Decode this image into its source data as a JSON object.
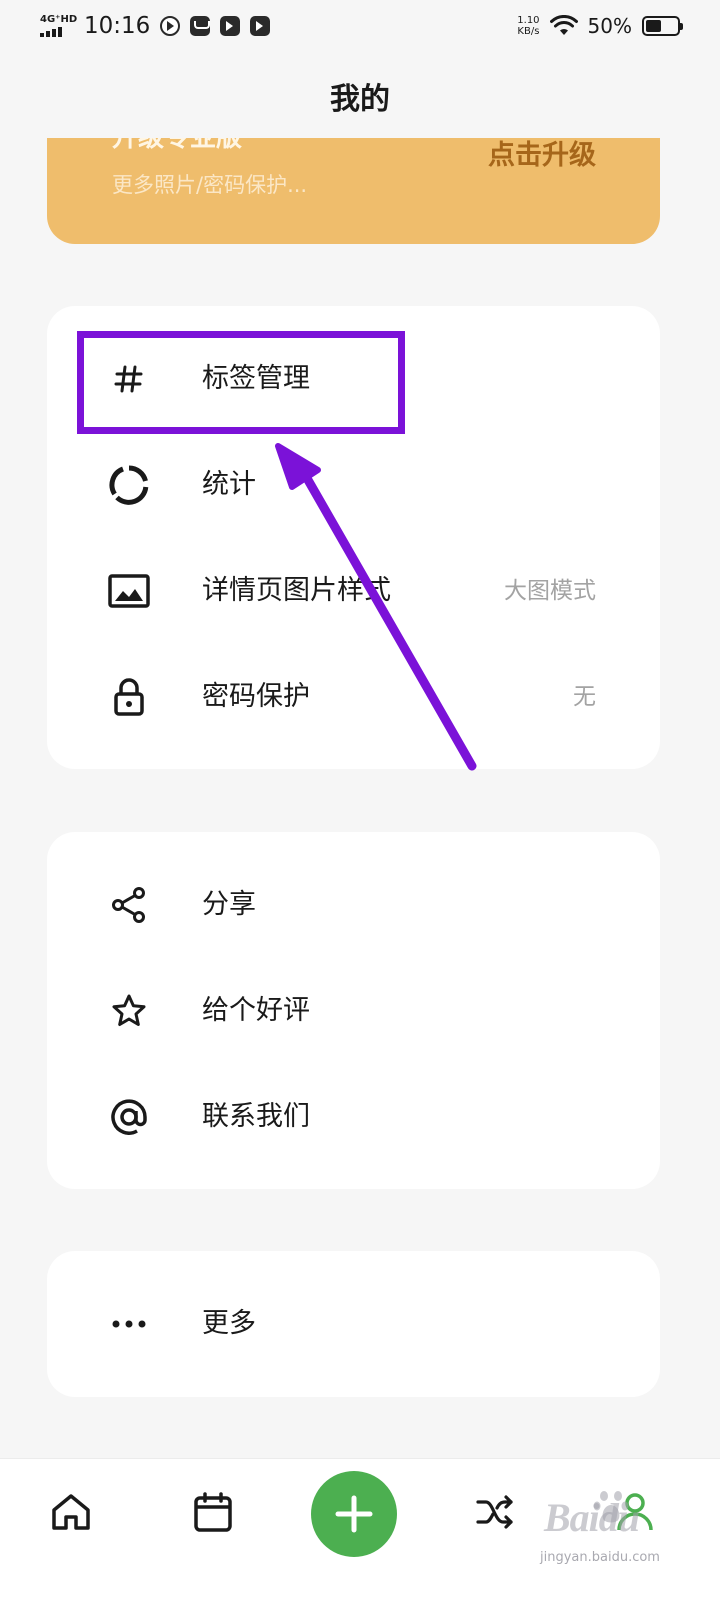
{
  "status_bar": {
    "network": "4G⁺HD",
    "time": "10:16",
    "speed_value": "1.10",
    "speed_unit": "KB/s",
    "battery_percent": "50%",
    "battery_level": 0.5
  },
  "header": {
    "title": "我的"
  },
  "upgrade": {
    "title": "升级专业版",
    "subtitle": "更多照片/密码保护...",
    "button": "点击升级"
  },
  "settings_group": [
    {
      "label": "标签管理",
      "icon": "hash-icon",
      "value": ""
    },
    {
      "label": "统计",
      "icon": "ring-chart-icon",
      "value": ""
    },
    {
      "label": "详情页图片样式",
      "icon": "image-icon",
      "value": "大图模式"
    },
    {
      "label": "密码保护",
      "icon": "lock-icon",
      "value": "无"
    }
  ],
  "social_group": [
    {
      "label": "分享",
      "icon": "share-icon"
    },
    {
      "label": "给个好评",
      "icon": "star-icon"
    },
    {
      "label": "联系我们",
      "icon": "at-icon"
    }
  ],
  "more_group": [
    {
      "label": "更多",
      "icon": "more-dots-icon"
    }
  ],
  "bottom_nav": {
    "items": [
      "home-icon",
      "calendar-icon",
      "add-icon",
      "shuffle-icon",
      "profile-icon"
    ],
    "add_color": "#4caf50"
  },
  "watermark": {
    "brand": "Baidu",
    "site": "jingyan.baidu.com"
  },
  "colors": {
    "upgrade_bg": "#efbd6c",
    "upgrade_button": "#a6661a",
    "annotation": "#7b12d8",
    "background": "#f6f6f6"
  }
}
